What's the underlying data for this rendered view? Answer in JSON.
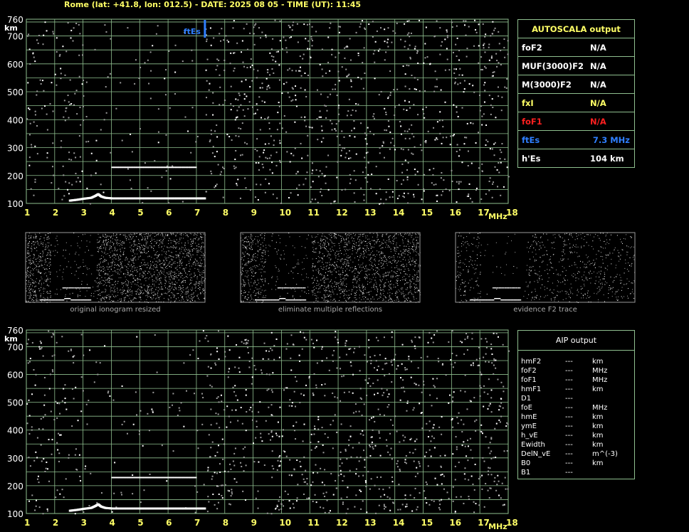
{
  "header": "Rome (lat: +41.8, lon: 012.5) - DATE: 2025 08 05 - TIME (UT): 11:45",
  "colors": {
    "grid": "#8fbf8f",
    "axis_text": "#ffff66",
    "es_marker": "#2f7fff",
    "fof1": "#ff2020"
  },
  "autoscala": {
    "title": "AUTOSCALA output",
    "rows": [
      {
        "label": "foF2",
        "value": "N/A",
        "color": "#ffffff"
      },
      {
        "label": "MUF(3000)F2",
        "value": "N/A",
        "color": "#ffffff"
      },
      {
        "label": "M(3000)F2",
        "value": "N/A",
        "color": "#ffffff"
      },
      {
        "label": "fxI",
        "value": "N/A",
        "color": "#ffff66"
      },
      {
        "label": "foF1",
        "value": "N/A",
        "color": "#ff2020"
      },
      {
        "label": "ftEs",
        "value": "7.3 MHz",
        "color": "#2f7fff"
      },
      {
        "label": "h'Es",
        "value": "104    km",
        "color": "#ffffff"
      }
    ]
  },
  "aip": {
    "title": "AIP output",
    "rows": [
      {
        "name": "hmF2",
        "value": "---",
        "unit": "km"
      },
      {
        "name": "foF2",
        "value": "---",
        "unit": "MHz"
      },
      {
        "name": "foF1",
        "value": "---",
        "unit": "MHz"
      },
      {
        "name": "hmF1",
        "value": "---",
        "unit": "km"
      },
      {
        "name": "D1",
        "value": "---",
        "unit": ""
      },
      {
        "name": "foE",
        "value": "---",
        "unit": "MHz"
      },
      {
        "name": "hmE",
        "value": "---",
        "unit": "km"
      },
      {
        "name": "ymE",
        "value": "---",
        "unit": "km"
      },
      {
        "name": "h_vE",
        "value": "---",
        "unit": "km"
      },
      {
        "name": "Ewidth",
        "value": "---",
        "unit": "km"
      },
      {
        "name": "DelN_vE",
        "value": "---",
        "unit": "m^(-3)"
      },
      {
        "name": "B0",
        "value": "---",
        "unit": "km"
      },
      {
        "name": "B1",
        "value": "---",
        "unit": ""
      }
    ]
  },
  "captions": [
    "original ionogram resized",
    "eliminate multiple reflections",
    "evidence F2 trace"
  ],
  "chart_data": [
    {
      "type": "scatter",
      "x_unit": "MHz",
      "y_unit": "km",
      "xlim": [
        1,
        18
      ],
      "ylim": [
        100,
        760
      ],
      "xticks": [
        1,
        2,
        3,
        4,
        5,
        6,
        7,
        8,
        9,
        10,
        11,
        12,
        13,
        14,
        15,
        16,
        17,
        18
      ],
      "yticks": [
        100,
        200,
        300,
        400,
        500,
        600,
        700,
        760
      ],
      "grid": true,
      "es_marker": {
        "label": "ftEs",
        "freq": 7.3
      },
      "traces": [
        {
          "x": [
            2.5,
            2.75,
            3.0,
            3.25,
            3.4,
            3.5,
            3.6,
            3.75,
            4.0,
            4.5,
            5.0,
            5.5,
            6.0,
            6.5,
            7.0,
            7.3
          ],
          "y": [
            110,
            113,
            117,
            120,
            127,
            133,
            125,
            120,
            118,
            118,
            118,
            118,
            118,
            118,
            118,
            118
          ]
        },
        {
          "x": [
            4.0,
            4.5,
            5.0,
            5.5,
            6.0,
            6.5,
            7.0
          ],
          "y": [
            228,
            228,
            228,
            228,
            228,
            228,
            228
          ]
        }
      ]
    },
    {
      "type": "scatter",
      "x_unit": "MHz",
      "y_unit": "km",
      "xlim": [
        1,
        18
      ],
      "ylim": [
        100,
        760
      ],
      "xticks": [
        1,
        2,
        3,
        4,
        5,
        6,
        7,
        8,
        9,
        10,
        11,
        12,
        13,
        14,
        15,
        16,
        17,
        18
      ],
      "yticks": [
        100,
        200,
        300,
        400,
        500,
        600,
        700,
        760
      ],
      "grid": true,
      "traces": [
        {
          "x": [
            2.5,
            2.75,
            3.0,
            3.25,
            3.4,
            3.5,
            3.6,
            3.75,
            4.0,
            4.5,
            5.0,
            5.5,
            6.0,
            6.5,
            7.0,
            7.3
          ],
          "y": [
            110,
            113,
            117,
            120,
            127,
            133,
            125,
            120,
            118,
            118,
            118,
            118,
            118,
            118,
            118,
            118
          ]
        },
        {
          "x": [
            4.0,
            4.5,
            5.0,
            5.5,
            6.0,
            6.5,
            7.0
          ],
          "y": [
            228,
            228,
            228,
            228,
            228,
            228,
            228
          ]
        }
      ]
    }
  ]
}
